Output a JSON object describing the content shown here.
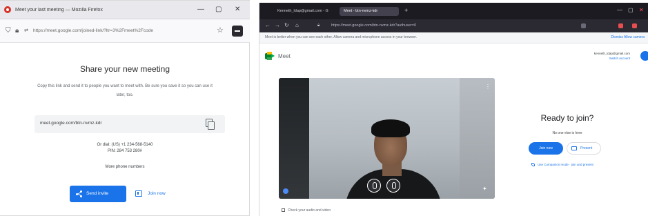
{
  "left_window": {
    "title": "Meet your last meeting — Mozilla Firefox",
    "url": "https://meet.google.com/joined-link/?ltr=3%2Fmeet%2Fcode",
    "heading": "Share your new meeting",
    "description": "Copy this link and send it to people you want to meet with. Be sure you save it so you can use it later, too.",
    "meeting_link": "meet.google.com/btn-nvmz-kdr",
    "dial_in": "Or dial: (US) +1 234-568-5140 PIN: 284 753 280#",
    "dial_in_line1": "Or dial: (US) +1 234-568-5140",
    "dial_in_line2": "PIN: 284 753 280#",
    "more_phone_numbers": "More phone numbers",
    "send_invite_label": "Send invite",
    "join_now_label": "Join now"
  },
  "right_window": {
    "tabs": [
      "Kenneth_ldap@gmail.com - G",
      "Meet - btn-nvmz-kdr"
    ],
    "url": "https://meet.google.com/btn-nvmz-kdr?authuser=0",
    "banner_text": "Meet is better when you can see each other. Allow camera and microphone access in your browser.",
    "banner_action": "Dismiss   Allow camera",
    "app_name": "Meet",
    "account_line1": "kenneth_ldap@gmail.com",
    "account_line2": "Switch account",
    "ready_title": "Ready to join?",
    "no_one_here": "No one else is here",
    "join_now_label": "Join now",
    "present_label": "Present",
    "companion_text": "Use Companion mode · join and present",
    "check_audio": "Check your audio and video"
  },
  "colors": {
    "accent": "#1a73e8",
    "meet_green": "#00832d",
    "dark_chrome": "#1c1b22"
  },
  "icons": [
    "copy-icon",
    "share-icon",
    "join-meeting-icon",
    "mic-icon",
    "effects-icon",
    "more-options-icon",
    "present-icon",
    "phone-icon"
  ]
}
